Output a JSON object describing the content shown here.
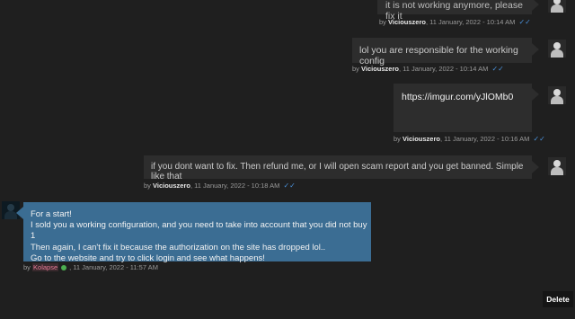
{
  "messages": [
    {
      "text": "it is not working anymore, please fix it",
      "by": "by",
      "user": "Viciouszero",
      "date": ", 11 January, 2022 - 10:14 AM",
      "ticks": "✓✓"
    },
    {
      "text": "lol you are responsible for the working config",
      "by": "by",
      "user": "Viciouszero",
      "date": ", 11 January, 2022 - 10:14 AM",
      "ticks": "✓✓"
    },
    {
      "text": "https://imgur.com/yJlOMb0",
      "by": "by",
      "user": "Viciouszero",
      "date": ", 11 January, 2022 - 10:16 AM",
      "ticks": "✓✓"
    },
    {
      "text": "if you dont want to fix. Then refund me, or I will open scam report and you get banned. Simple like that",
      "by": "by",
      "user": "Viciouszero",
      "date": ", 11 January, 2022 - 10:18 AM",
      "ticks": "✓✓"
    },
    {
      "lines": [
        "For a start!",
        "I sold you a working configuration, and you need to take into account that you did not buy 1",
        "Then again, I can't fix it because the authorization on the site has dropped lol..",
        "Go to the website and try to click login and see what happens!"
      ],
      "by": "by",
      "user": "Kolapse",
      "date": ", 11 January, 2022 - 11:57 AM"
    }
  ],
  "delete_label": "Delete",
  "colors": {
    "background": "#1f1f1f",
    "bubble": "#2d2d2d",
    "bubble_reply": "#3b6d93",
    "tick": "#4a90d9",
    "username_highlight": "#e87a97",
    "online": "#4caf50"
  }
}
